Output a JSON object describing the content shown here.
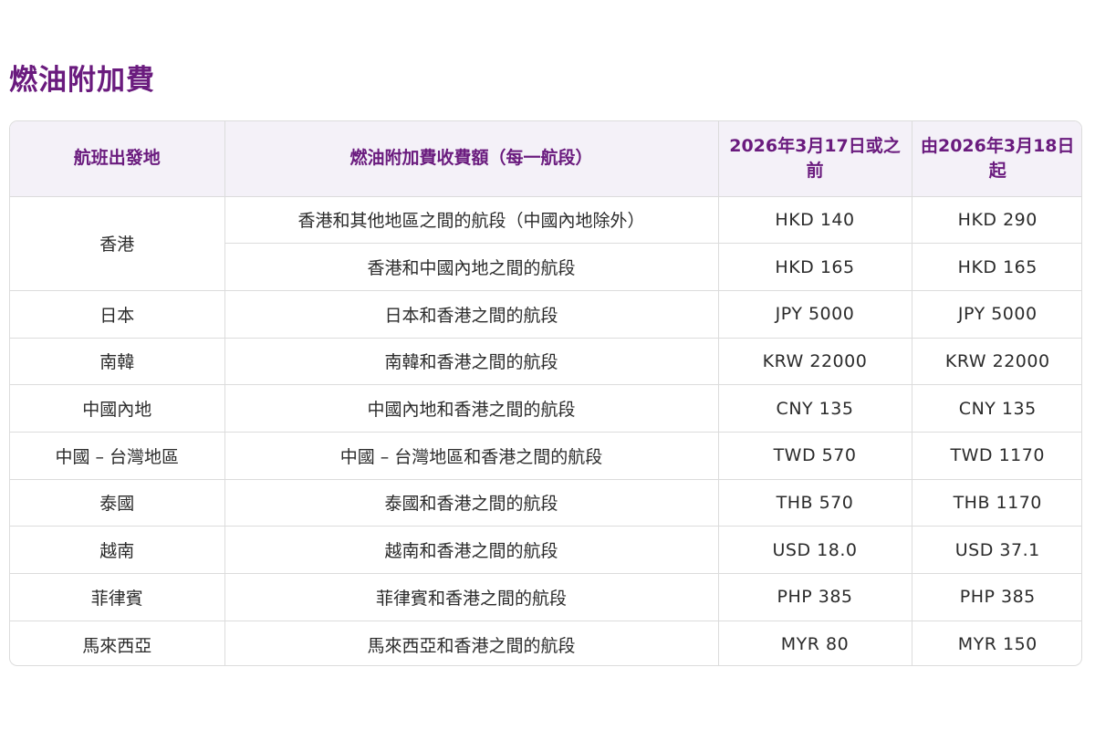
{
  "title": "燃油附加費",
  "table": {
    "headers": [
      "航班出發地",
      "燃油附加費收費額（每一航段）",
      "2026年3月17日或之前",
      "由2026年3月18日起"
    ],
    "rows": [
      {
        "origin": "香港",
        "sector": "香港和其他地區之間的航段（中國內地除外）",
        "before": "HKD 140",
        "after": "HKD 290"
      },
      {
        "origin": "",
        "sector": "香港和中國內地之間的航段",
        "before": "HKD 165",
        "after": "HKD 165"
      },
      {
        "origin": "日本",
        "sector": "日本和香港之間的航段",
        "before": "JPY 5000",
        "after": "JPY 5000"
      },
      {
        "origin": "南韓",
        "sector": "南韓和香港之間的航段",
        "before": "KRW 22000",
        "after": "KRW 22000"
      },
      {
        "origin": "中國內地",
        "sector": "中國內地和香港之間的航段",
        "before": "CNY 135",
        "after": "CNY 135"
      },
      {
        "origin": "中國 – 台灣地區",
        "sector": "中國 – 台灣地區和香港之間的航段",
        "before": "TWD 570",
        "after": "TWD 1170"
      },
      {
        "origin": "泰國",
        "sector": "泰國和香港之間的航段",
        "before": "THB 570",
        "after": "THB 1170"
      },
      {
        "origin": "越南",
        "sector": "越南和香港之間的航段",
        "before": "USD 18.0",
        "after": "USD 37.1"
      },
      {
        "origin": "菲律賓",
        "sector": "菲律賓和香港之間的航段",
        "before": "PHP 385",
        "after": "PHP 385"
      },
      {
        "origin": "馬來西亞",
        "sector": "馬來西亞和香港之間的航段",
        "before": "MYR 80",
        "after": "MYR 150"
      }
    ]
  },
  "colors": {
    "accent": "#6a1b7e",
    "header_bg": "#f4f1f8",
    "border": "#dcdcdc"
  }
}
